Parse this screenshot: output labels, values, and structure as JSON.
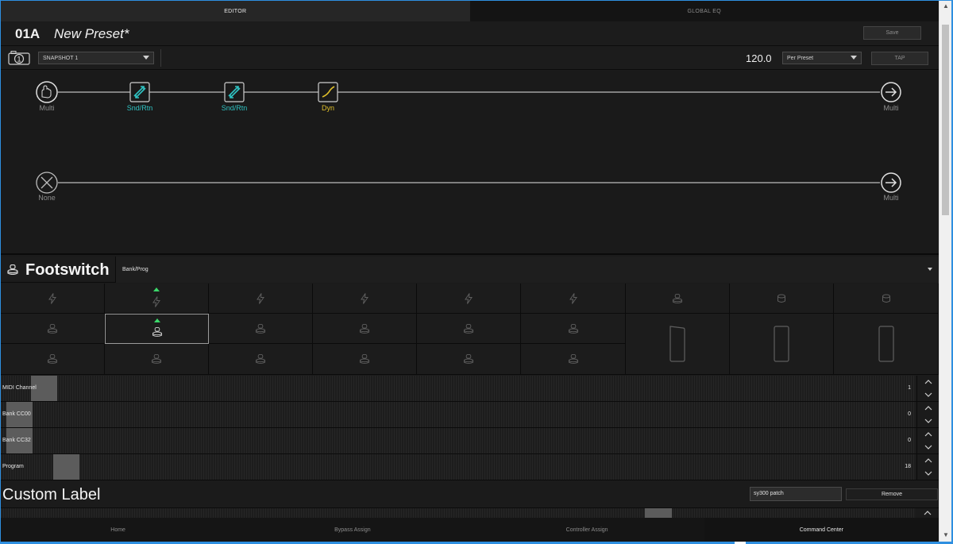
{
  "tabs": [
    {
      "label": "EDITOR",
      "active": true
    },
    {
      "label": "GLOBAL EQ",
      "active": false
    }
  ],
  "preset": {
    "number": "01A",
    "name": "New Preset*",
    "save_label": "Save"
  },
  "snapshot": {
    "selected": "SNAPSHOT 1",
    "camera_number": "1"
  },
  "tempo": {
    "value": "120.0",
    "mode": "Per Preset",
    "tap_label": "TAP"
  },
  "signal_flow": {
    "path1": {
      "input_label": "Multi",
      "blocks": [
        {
          "label": "Snd/Rtn",
          "color": "#2fc2c2",
          "icon": "send-return-icon"
        },
        {
          "label": "Snd/Rtn",
          "color": "#2fc2c2",
          "icon": "send-return-icon"
        },
        {
          "label": "Dyn",
          "color": "#e0c02a",
          "icon": "dynamics-icon"
        }
      ],
      "output_label": "Multi"
    },
    "path2": {
      "input_label": "None",
      "output_label": "Multi"
    }
  },
  "footswitch": {
    "title": "Footswitch",
    "mode": "Bank/Prog"
  },
  "params": [
    {
      "label": "MIDI Channel",
      "value": "1",
      "level": 0.08
    },
    {
      "label": "Bank CC00",
      "value": "0",
      "level": 0.0
    },
    {
      "label": "Bank CC32",
      "value": "0",
      "level": 0.0
    },
    {
      "label": "Program",
      "value": "18",
      "level": 0.14
    }
  ],
  "custom_label": {
    "title": "Custom Label",
    "value": "sy300 patch",
    "remove_label": "Remove"
  },
  "bottom_nav": [
    {
      "label": "Home",
      "active": false
    },
    {
      "label": "Bypass Assign",
      "active": false
    },
    {
      "label": "Controller Assign",
      "active": false
    },
    {
      "label": "Command Center",
      "active": true
    }
  ],
  "colors": {
    "accent_teal": "#2fc2c2",
    "accent_yellow": "#e0c02a",
    "indicator_green": "#3bd86a",
    "window_border": "#2e8fe0"
  }
}
